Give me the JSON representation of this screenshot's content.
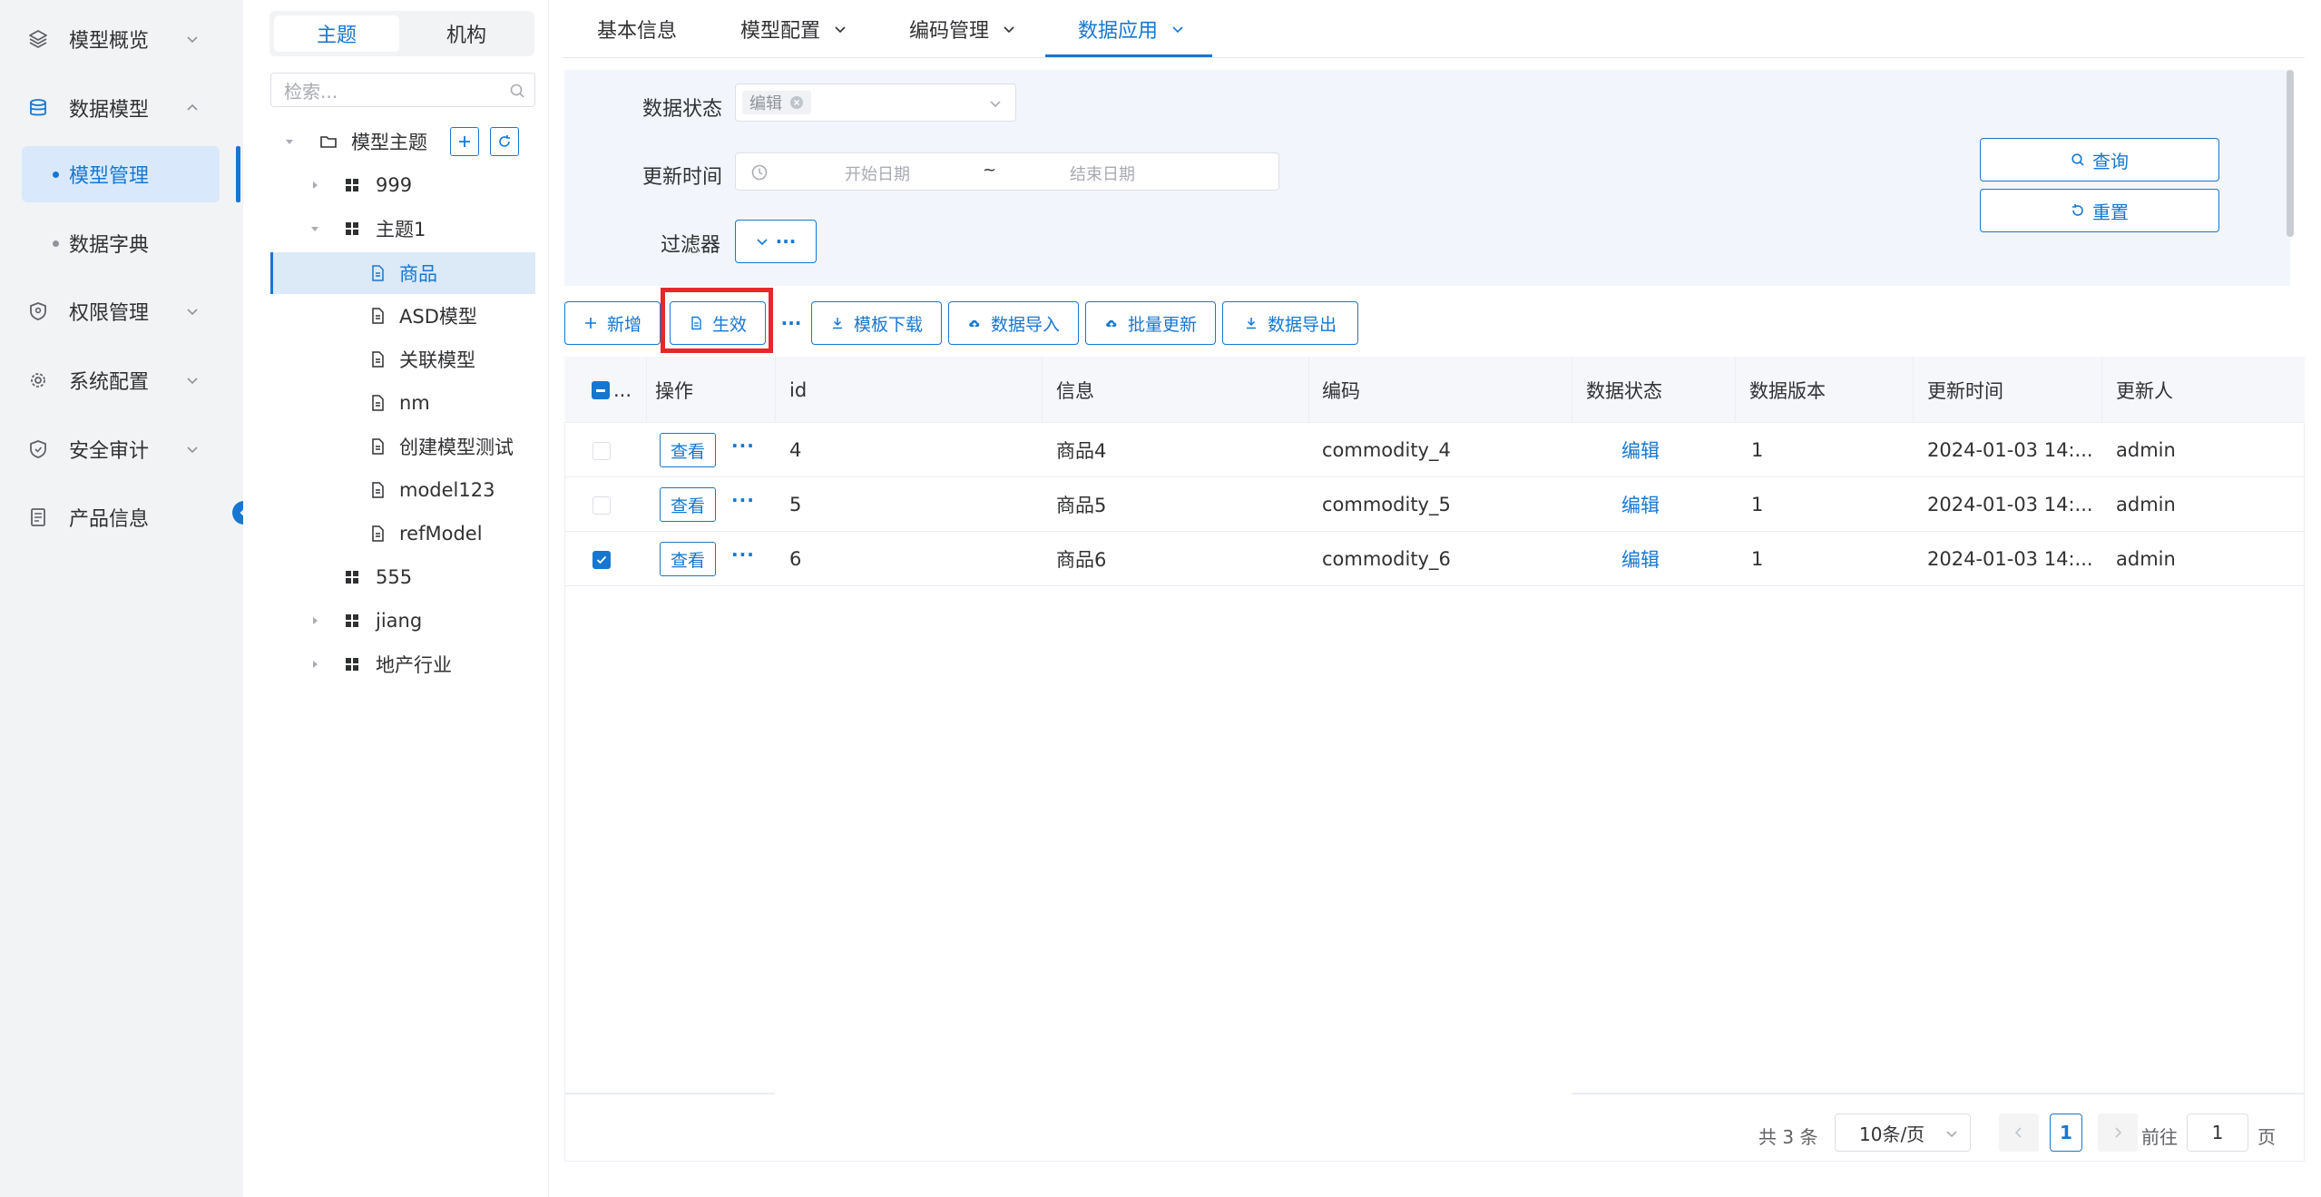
{
  "sidebar": {
    "items": [
      {
        "label": "模型概览",
        "icon": "layers-icon"
      },
      {
        "label": "数据模型",
        "icon": "database-icon"
      },
      {
        "label": "权限管理",
        "icon": "shield-icon"
      },
      {
        "label": "系统配置",
        "icon": "gear-icon"
      },
      {
        "label": "安全审计",
        "icon": "shield-check-icon"
      },
      {
        "label": "产品信息",
        "icon": "document-icon"
      }
    ],
    "sub_items": [
      {
        "label": "模型管理",
        "active": true
      },
      {
        "label": "数据字典",
        "active": false
      }
    ]
  },
  "tree": {
    "segment": {
      "tab1": "主题",
      "tab2": "机构"
    },
    "search_placeholder": "检索...",
    "root": "模型主题",
    "nodes": {
      "n999": "999",
      "theme1": "主题1",
      "goods": "商品",
      "asd": "ASD模型",
      "related": "关联模型",
      "nm": "nm",
      "create_test": "创建模型测试",
      "model123": "model123",
      "refmodel": "refModel",
      "n555": "555",
      "jiang": "jiang",
      "estate": "地产行业"
    }
  },
  "tabs": {
    "basic": "基本信息",
    "model_config": "模型配置",
    "code_mgmt": "编码管理",
    "data_app": "数据应用"
  },
  "filters": {
    "status_label": "数据状态",
    "status_tag": "编辑",
    "update_time_label": "更新时间",
    "start_placeholder": "开始日期",
    "range_sep": "~",
    "end_placeholder": "结束日期",
    "filter_label": "过滤器",
    "filter_more": "···",
    "query_btn": "查询",
    "reset_btn": "重置"
  },
  "toolbar": {
    "add": "新增",
    "activate": "生效",
    "more": "···",
    "template_download": "模板下载",
    "data_import": "数据导入",
    "batch_update": "批量更新",
    "data_export": "数据导出"
  },
  "table": {
    "headers": {
      "select": "...",
      "action": "操作",
      "id": "id",
      "info": "信息",
      "code": "编码",
      "status": "数据状态",
      "version": "数据版本",
      "update_time": "更新时间",
      "updater": "更新人"
    },
    "view_label": "查看",
    "more_label": "···",
    "rows": [
      {
        "id": "4",
        "info": "商品4",
        "code": "commodity_4",
        "status": "编辑",
        "version": "1",
        "update_time": "2024-01-03 14:...",
        "updater": "admin",
        "checked": false
      },
      {
        "id": "5",
        "info": "商品5",
        "code": "commodity_5",
        "status": "编辑",
        "version": "1",
        "update_time": "2024-01-03 14:...",
        "updater": "admin",
        "checked": false
      },
      {
        "id": "6",
        "info": "商品6",
        "code": "commodity_6",
        "status": "编辑",
        "version": "1",
        "update_time": "2024-01-03 14:...",
        "updater": "admin",
        "checked": true
      }
    ]
  },
  "pagination": {
    "total": "共 3 条",
    "page_size": "10条/页",
    "current": "1",
    "goto_prefix": "前往",
    "goto_value": "1",
    "goto_suffix": "页"
  },
  "colors": {
    "primary": "#1677d2",
    "highlight": "#e5282b",
    "sidebar_bg": "#f2f3f5",
    "filter_bg": "#f2f6fc"
  }
}
